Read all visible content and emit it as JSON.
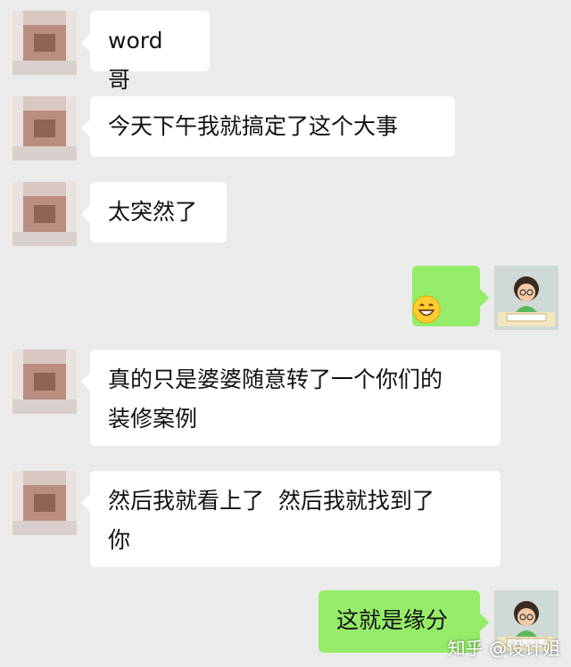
{
  "messages": [
    {
      "side": "left",
      "text": "word 哥"
    },
    {
      "side": "left",
      "text": "今天下午我就搞定了这个大事"
    },
    {
      "side": "left",
      "text": "太突然了"
    },
    {
      "side": "right",
      "emoji": "grinning-face-emoji"
    },
    {
      "side": "left",
      "text": "真的只是婆婆随意转了一个你们的\n装修案例"
    },
    {
      "side": "left",
      "text": "然后我就看上了  然后我就找到了\n你"
    },
    {
      "side": "right",
      "text": "这就是缘分"
    }
  ],
  "watermark": "知乎 @设计姐",
  "colors": {
    "background": "#ebebeb",
    "incoming_bubble": "#ffffff",
    "outgoing_bubble": "#95ec69"
  }
}
